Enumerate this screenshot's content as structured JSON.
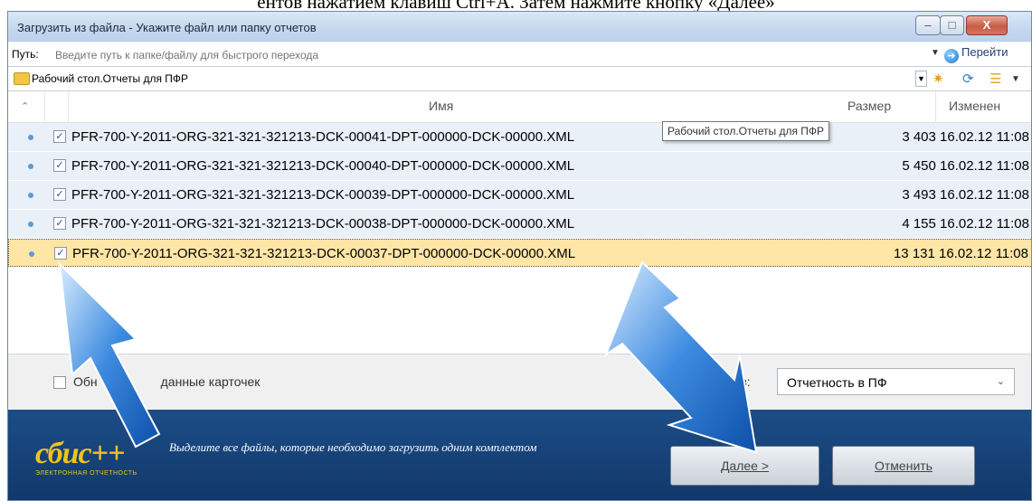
{
  "doc": {
    "caption": "ентов нажатием клавиш Ctrl+A. Затем нажмите кнопку «Далее»"
  },
  "window": {
    "title": "Загрузить из файла - Укажите файл или папку отчетов",
    "buttons": {
      "minimize": "–",
      "maximize": "□",
      "close": "X"
    }
  },
  "path": {
    "label": "Путь:",
    "placeholder": "Введите путь к папке/файлу для быстрого перехода",
    "go_label": "Перейти"
  },
  "folder": {
    "name": "Рабочий стол.Отчеты для ПФР"
  },
  "grid": {
    "columns": {
      "name": "Имя",
      "size": "Размер",
      "modified": "Изменен"
    },
    "tooltip": "Рабочий стол.Отчеты для ПФР",
    "rows": [
      {
        "name": "PFR-700-Y-2011-ORG-321-321-321213-DCK-00041-DPT-000000-DCK-00000.XML",
        "meta": "3 403 16.02.12 11:08",
        "checked": true,
        "selected": false
      },
      {
        "name": "PFR-700-Y-2011-ORG-321-321-321213-DCK-00040-DPT-000000-DCK-00000.XML",
        "meta": "5 450 16.02.12 11:08",
        "checked": true,
        "selected": false
      },
      {
        "name": "PFR-700-Y-2011-ORG-321-321-321213-DCK-00039-DPT-000000-DCK-00000.XML",
        "meta": "3 493 16.02.12 11:08",
        "checked": true,
        "selected": false
      },
      {
        "name": "PFR-700-Y-2011-ORG-321-321-321213-DCK-00038-DPT-000000-DCK-00000.XML",
        "meta": "4 155 16.02.12 11:08",
        "checked": true,
        "selected": false
      },
      {
        "name": "PFR-700-Y-2011-ORG-321-321-321213-DCK-00037-DPT-000000-DCK-00000.XML",
        "meta": "13 131 16.02.12 11:08",
        "checked": true,
        "selected": true
      }
    ]
  },
  "options": {
    "update_label": "Обн",
    "update_label_tail": "данные карточек",
    "type_label": "Т",
    "type_label_tail": "ов:",
    "type_value": "Отчетность в ПФ"
  },
  "footer": {
    "logo": "сбис++",
    "logo_sub": "ЭЛЕКТРОННАЯ ОТЧЕТНОСТЬ",
    "hint": "Выделите все файлы, которые необходимо загрузить одним комплектом",
    "next_label": "Далее >",
    "cancel_label": "Отменить"
  },
  "colors": {
    "footer": "#1c4d87",
    "selected_row": "#ffe6a6",
    "row": "#e9f0f8",
    "logo": "#f3c21e",
    "arrow": "#1f6fd0"
  }
}
